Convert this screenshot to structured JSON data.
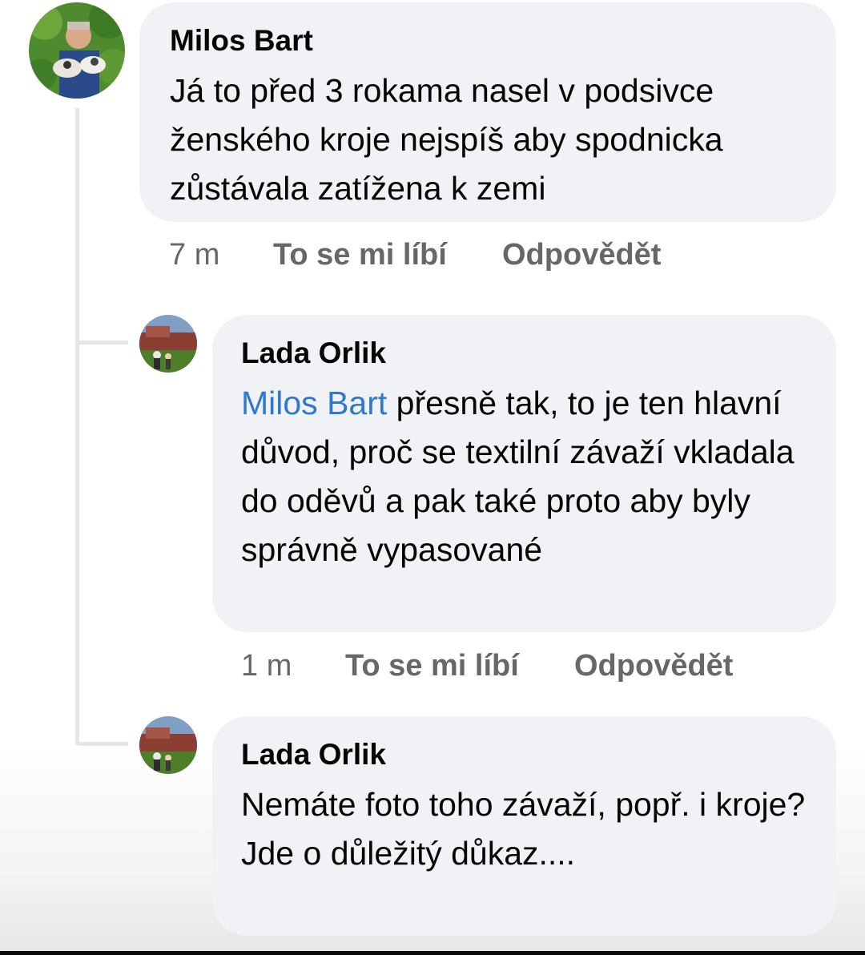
{
  "comments": [
    {
      "author": "Milos Bart",
      "text": "Já to před 3 rokama nasel v podsivce ženského kroje nejspíš aby spodnicka zůstávala zatížena k zemi",
      "time": "7 m",
      "like_label": "To se mi líbí",
      "reply_label": "Odpovědět"
    }
  ],
  "replies": [
    {
      "author": "Lada Orlik",
      "mention": "Milos Bart",
      "text": " přesně tak, to je ten hlavní důvod, proč se textilní závaží vkladala do oděvů a pak také proto aby byly správně vypasované",
      "time": "1 m",
      "like_label": "To se mi líbí",
      "reply_label": "Odpovědět"
    },
    {
      "author": "Lada Orlik",
      "text_line1": "Nemáte foto toho závaží, popř. i kroje?",
      "text_line2": "Jde o důležitý důkaz...."
    }
  ],
  "colors": {
    "bubble": "#f0f2f5",
    "mention": "#2f78d1",
    "meta": "#65676b",
    "thread_line": "#e4e6ea"
  }
}
